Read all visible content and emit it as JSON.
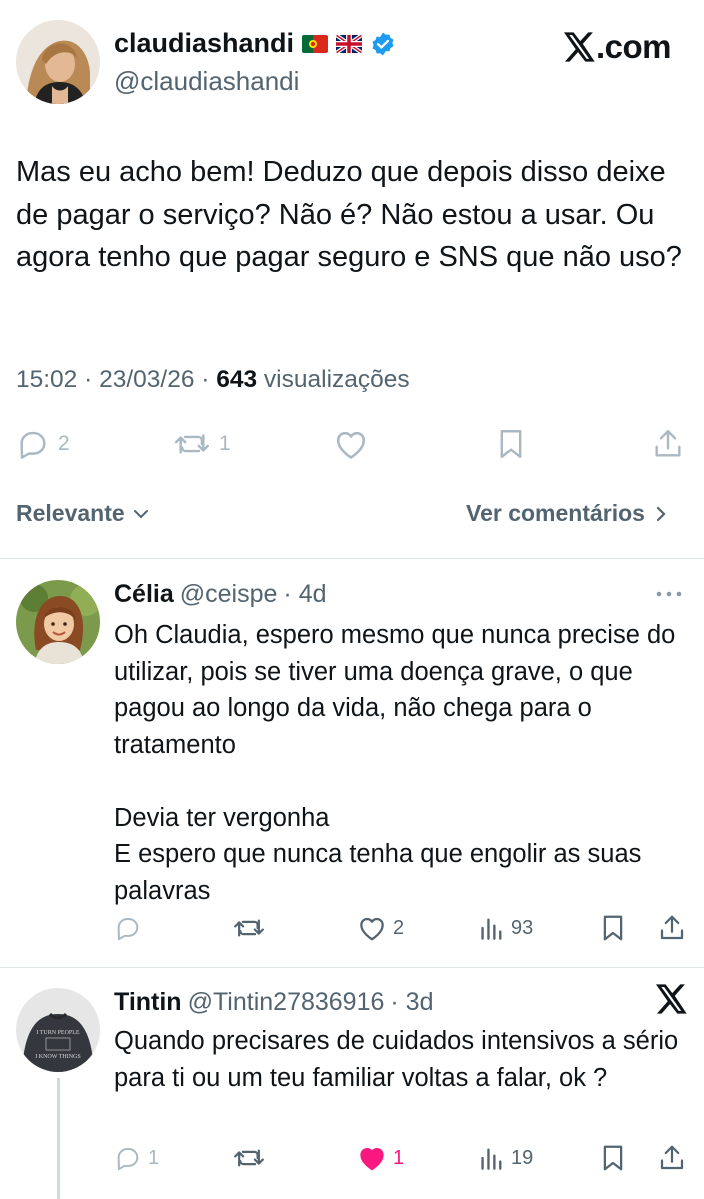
{
  "main_tweet": {
    "author_name": "claudiashandi",
    "handle": "@claudiashandi",
    "site_label": ".com",
    "text": "Mas eu acho bem! Deduzo que depois disso deixe de pagar o serviço? Não é? Não estou a usar. Ou agora tenho que pagar seguro e SNS que não uso?",
    "time": "15:02 · 23/03/26 · ",
    "views_count": "643",
    "views_label": " visualizações",
    "reply_count": "2",
    "retweet_count": "1",
    "icons": [
      "reply-icon",
      "retweet-icon",
      "like-icon",
      "bookmark-icon",
      "share-icon"
    ]
  },
  "sort_bar": {
    "sort_label": "Relevante",
    "comments_link": "Ver comentários"
  },
  "replies": [
    {
      "name": "Célia",
      "handle": "@ceispe",
      "age": "· 4d",
      "text": "Oh Claudia, espero mesmo que nunca precise do utilizar, pois se tiver uma doença grave, o que pagou ao longo da vida, não chega para o tratamento\n\nDevia ter vergonha\nE espero que nunca tenha que engolir as suas palavras",
      "like_count": "2",
      "view_count": "93"
    },
    {
      "name": "Tintin",
      "handle": "@Tintin27836916",
      "age": "· 3d",
      "text": "Quando precisares de cuidados intensivos a sério para ti ou um teu familiar voltas a falar, ok ?",
      "reply_count": "1",
      "like_count": "1",
      "view_count": "19",
      "shirt_text_1": "I TURN PEOPLE",
      "shirt_text_2": "I KNOW THINGS"
    }
  ],
  "colors": {
    "verified_blue": "#1d9bf0",
    "like_pink": "#f91880",
    "muted": "#536471"
  }
}
